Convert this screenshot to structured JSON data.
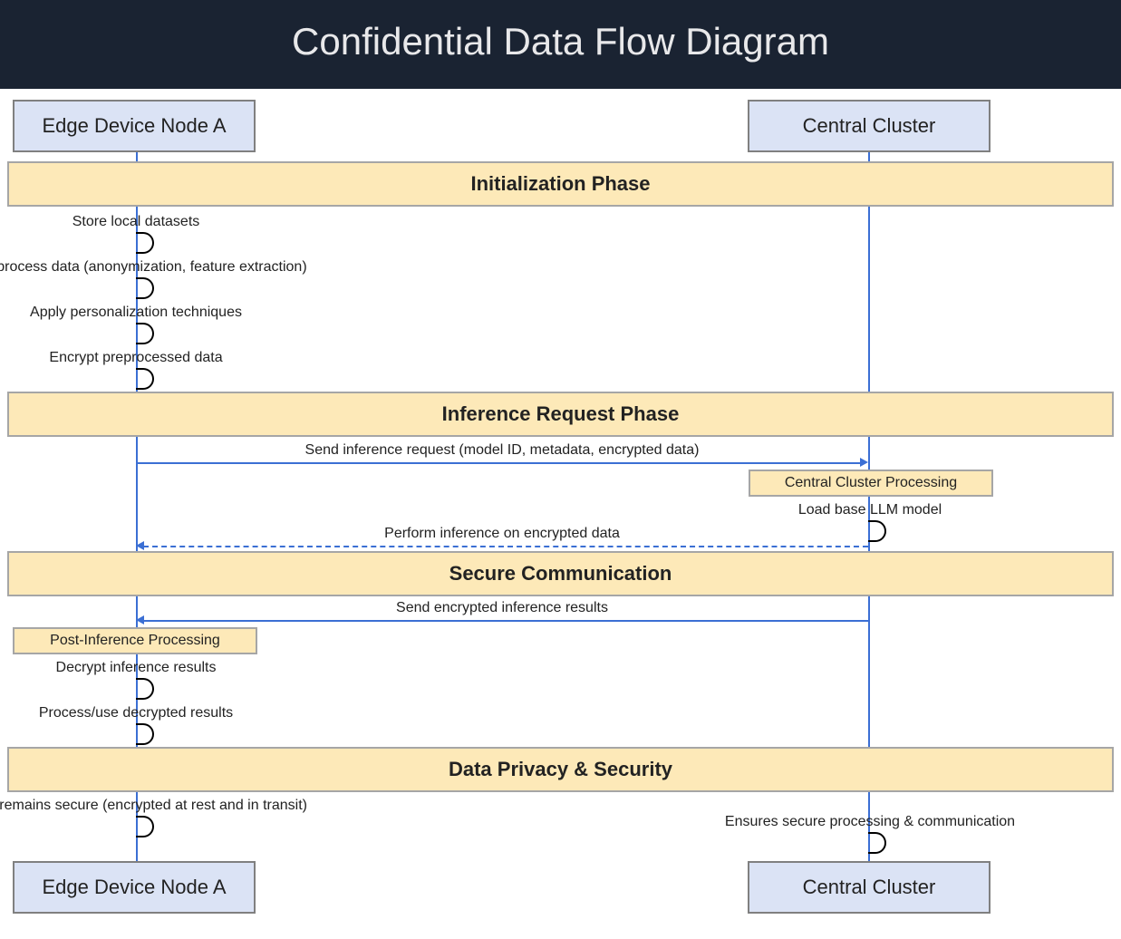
{
  "title": "Confidential Data Flow Diagram",
  "actors": {
    "edge": "Edge Device Node A",
    "cluster": "Central Cluster"
  },
  "sections": {
    "init": "Initialization Phase",
    "inference": "Inference Request Phase",
    "cluster_proc": "Central Cluster Processing",
    "secure": "Secure Communication",
    "post_inf": "Post-Inference Processing",
    "privacy": "Data Privacy & Security"
  },
  "messages": {
    "store_local": "Store local datasets",
    "preprocess": "Preprocess data (anonymization, feature extraction)",
    "apply_pers": "Apply personalization techniques",
    "encrypt_pre": "Encrypt preprocessed data",
    "send_req": "Send inference request (model ID, metadata, encrypted data)",
    "load_model": "Load base LLM model",
    "perform_inf": "Perform inference on encrypted data",
    "send_results": "Send encrypted inference results",
    "decrypt_res": "Decrypt inference results",
    "process_res": "Process/use decrypted results",
    "data_secure": "Data remains secure (encrypted at rest and in transit)",
    "ensure_secure": "Ensures secure processing & communication"
  }
}
